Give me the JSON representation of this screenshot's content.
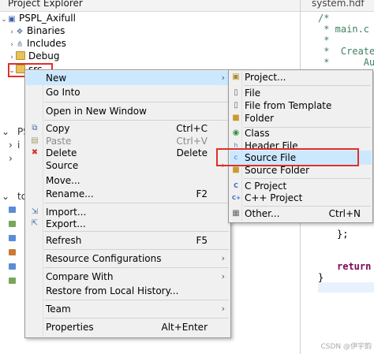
{
  "explorer": {
    "title": "Project Explorer",
    "project": "PSPL_Axifull",
    "children": [
      {
        "label": "Binaries",
        "icon": "binaries-icon"
      },
      {
        "label": "Includes",
        "icon": "includes-icon"
      },
      {
        "label": "Debug",
        "icon": "folder-icon"
      },
      {
        "label": "src",
        "icon": "folder-icon",
        "expanded": true
      }
    ],
    "fragments": {
      "ps": "PS",
      "i": "i",
      "to": "to"
    }
  },
  "editor": {
    "tab": "system.hdf",
    "lines": [
      "/*",
      " * main.c",
      " *",
      " *  Created",
      " *      Aut",
      "};",
      "return",
      "}"
    ]
  },
  "context_menu": {
    "items": [
      {
        "label": "New",
        "shortcut": "",
        "submenu": true,
        "selected": true
      },
      {
        "label": "Go Into",
        "shortcut": ""
      },
      {
        "label": "Open in New Window",
        "shortcut": ""
      },
      {
        "label": "Copy",
        "shortcut": "Ctrl+C",
        "icon": "copy-icon"
      },
      {
        "label": "Paste",
        "shortcut": "Ctrl+V",
        "icon": "paste-icon",
        "disabled": true
      },
      {
        "label": "Delete",
        "shortcut": "Delete",
        "icon": "delete-icon"
      },
      {
        "label": "Source",
        "shortcut": "",
        "submenu": true
      },
      {
        "label": "Move...",
        "shortcut": ""
      },
      {
        "label": "Rename...",
        "shortcut": "F2"
      },
      {
        "label": "Import...",
        "shortcut": "",
        "icon": "import-icon"
      },
      {
        "label": "Export...",
        "shortcut": "",
        "icon": "export-icon"
      },
      {
        "label": "Refresh",
        "shortcut": "F5"
      },
      {
        "label": "Resource Configurations",
        "shortcut": "",
        "submenu": true
      },
      {
        "label": "Compare With",
        "shortcut": "",
        "submenu": true
      },
      {
        "label": "Restore from Local History...",
        "shortcut": ""
      },
      {
        "label": "Team",
        "shortcut": "",
        "submenu": true
      },
      {
        "label": "Properties",
        "shortcut": "Alt+Enter"
      }
    ]
  },
  "submenu": {
    "items": [
      {
        "label": "Project...",
        "shortcut": "",
        "icon": "project-icon"
      },
      {
        "label": "File",
        "shortcut": "",
        "icon": "file-icon"
      },
      {
        "label": "File from Template",
        "shortcut": "",
        "icon": "file-template-icon"
      },
      {
        "label": "Folder",
        "shortcut": "",
        "icon": "folder-icon"
      },
      {
        "label": "Class",
        "shortcut": "",
        "icon": "class-icon"
      },
      {
        "label": "Header File",
        "shortcut": "",
        "icon": "header-file-icon"
      },
      {
        "label": "Source File",
        "shortcut": "",
        "icon": "source-file-icon",
        "selected": true
      },
      {
        "label": "Source Folder",
        "shortcut": "",
        "icon": "source-folder-icon"
      },
      {
        "label": "C Project",
        "shortcut": "",
        "icon": "c-project-icon"
      },
      {
        "label": "C++ Project",
        "shortcut": "",
        "icon": "cpp-project-icon"
      },
      {
        "label": "Other...",
        "shortcut": "Ctrl+N",
        "icon": "other-icon"
      }
    ]
  },
  "watermark": "CSDN @伊宇韵",
  "colors": {
    "menu_bg": "#f0f0f0",
    "selection": "#cce8ff",
    "highlight_box": "#e0302a",
    "comment": "#3f7f5f",
    "keyword": "#7f0055"
  }
}
